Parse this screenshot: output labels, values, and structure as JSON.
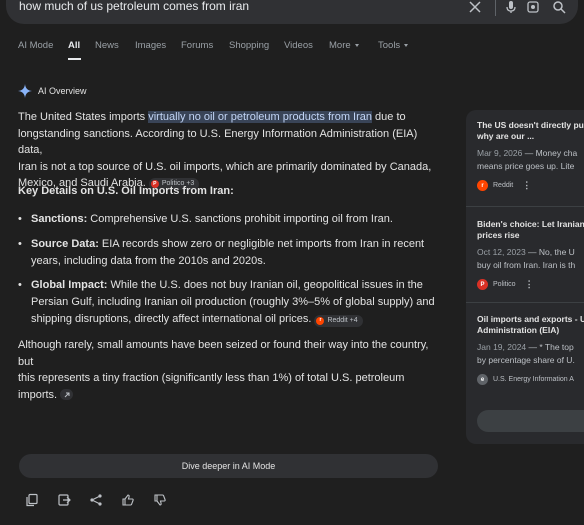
{
  "search": {
    "query": "how much of us petroleum comes from iran"
  },
  "tabs": [
    {
      "label": "AI Mode"
    },
    {
      "label": "All"
    },
    {
      "label": "News"
    },
    {
      "label": "Images"
    },
    {
      "label": "Forums"
    },
    {
      "label": "Shopping"
    },
    {
      "label": "Videos"
    },
    {
      "label": "More"
    },
    {
      "label": "Tools"
    }
  ],
  "overview": {
    "title": "AI Overview",
    "intro_before": "The United States imports ",
    "intro_highlight": "virtually no oil or petroleum products from Iran",
    "intro_l1_after": " due to",
    "intro_l2": "longstanding sanctions. According to U.S. Energy Information Administration (EIA) data,",
    "intro_l3": "Iran is not a top source of U.S. oil imports, which are primarily dominated by Canada,",
    "intro_l4": "Mexico, and Saudi Arabia.",
    "intro_chip": "Politico +3",
    "key_heading": "Key Details on U.S. Oil Imports from Iran:",
    "bullets": [
      {
        "label": "Sanctions:",
        "l1": " Comprehensive U.S. sanctions prohibit importing oil from Iran."
      },
      {
        "label": "Source Data:",
        "l1": " EIA records show zero or negligible net imports from Iran in recent",
        "l2": "years, including data from the 2010s and 2020s."
      },
      {
        "label": "Global Impact:",
        "l1": " While the U.S. does not buy Iranian oil, geopolitical issues in the",
        "l2": "Persian Gulf, including Iranian oil production (roughly 3%–5% of global supply) and",
        "l3": "shipping disruptions, directly affect international oil prices.",
        "chip": "Reddit +4"
      }
    ],
    "closing_l1": "Although rarely, small amounts have been seized or found their way into the country, but",
    "closing_l2": "this represents a tiny fraction (significantly less than 1%) of total U.S. petroleum",
    "closing_l3": "imports.",
    "dive_deeper": "Dive deeper in AI Mode"
  },
  "sources": [
    {
      "title_l1": "The US doesn't directly pu",
      "title_l2": "why are our ...",
      "date": "Mar 9, 2026",
      "snip_l1": " — Money cha",
      "snip_l2": "means price goes up. Lite",
      "source": "Reddit"
    },
    {
      "title_l1": "Biden's choice: Let Iranian",
      "title_l2": "prices rise",
      "date": "Oct 12, 2023",
      "snip_l1": " — No, the U",
      "snip_l2": "buy oil from Iran. Iran is th",
      "source": "Politico"
    },
    {
      "title_l1": "Oil imports and exports - U",
      "title_l2": "Administration (EIA)",
      "date": "Jan 19, 2024",
      "snip_l1": " — * The top",
      "snip_l2": "by percentage share of U.",
      "source": "U.S. Energy Information A"
    }
  ],
  "colors": {
    "background": "#1f1f1f",
    "highlight": "#394457",
    "politico_red": "#d93025",
    "reddit_orange": "#ff4500",
    "ai_star_blue": "#8ab4f8"
  }
}
